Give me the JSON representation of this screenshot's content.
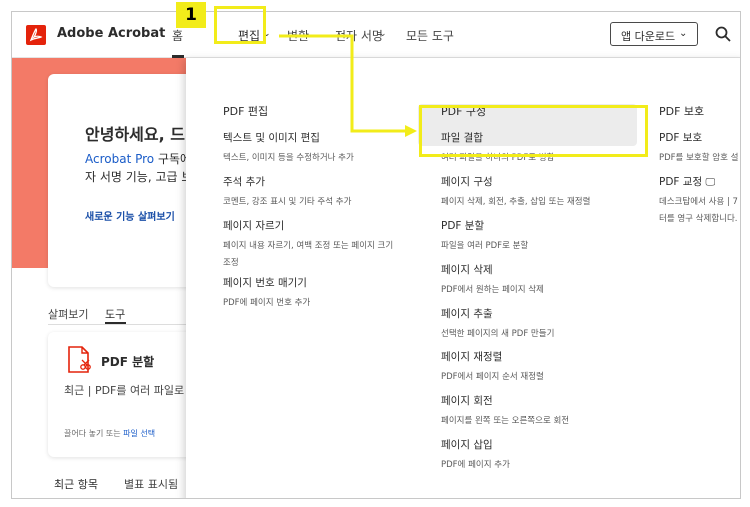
{
  "header": {
    "brand": "Adobe Acrobat",
    "nav": {
      "home": "홈",
      "edit": "편집",
      "convert": "변환",
      "sign": "전자 서명",
      "all_tools": "모든 도구"
    },
    "download_button": "앱 다운로드",
    "step_badge": "1"
  },
  "background": {
    "greeting": "안녕하세요, 드",
    "promo_link": "Acrobat Pro",
    "promo_rest": " 구독에",
    "promo_line2": "자 서명 기능, 고급 보",
    "new_features": "새로운 기능 살펴보기",
    "tabs": {
      "browse": "살펴보기",
      "tools": "도구"
    },
    "tool_card": {
      "title": "PDF 분할",
      "desc": "최근 | PDF를 여러 파일로 분",
      "drop_text": "끌어다 놓기 또는 ",
      "drop_link": "파일 선택"
    },
    "recent": "최근 항목",
    "starred": "별표 표시됨"
  },
  "dropdown": {
    "col1": {
      "heading": "PDF 편집",
      "items": [
        {
          "title": "텍스트 및 이미지 편집",
          "desc": "텍스트, 이미지 등을 수정하거나 추가"
        },
        {
          "title": "주석 추가",
          "desc": "코멘트, 강조 표시 및 기타 주석 추가"
        },
        {
          "title": "페이지 자르기",
          "desc": "페이지 내용 자르기, 여백 조정 또는 페이지 크기",
          "desc2": "조정"
        },
        {
          "title": "페이지 번호 매기기",
          "desc": "PDF에 페이지 번호 추가"
        }
      ]
    },
    "col2": {
      "heading": "PDF 구성",
      "items": [
        {
          "title": "파일 결합",
          "desc": "여러 파일을 하나의 PDF로 병합"
        },
        {
          "title": "페이지 구성",
          "desc": "페이지 삭제, 회전, 추출, 삽입 또는 재정렬"
        },
        {
          "title": "PDF 분할",
          "desc": "파일을 여러 PDF로 분할"
        },
        {
          "title": "페이지 삭제",
          "desc": "PDF에서 원하는 페이지 삭제"
        },
        {
          "title": "페이지 추출",
          "desc": "선택한 페이지의 새 PDF 만들기"
        },
        {
          "title": "페이지 재정렬",
          "desc": "PDF에서 페이지 순서 재정렬"
        },
        {
          "title": "페이지 회전",
          "desc": "페이지를 왼쪽 또는 오른쪽으로 회전"
        },
        {
          "title": "페이지 삽입",
          "desc": "PDF에 페이지 추가"
        }
      ]
    },
    "col3": {
      "heading": "PDF 보호",
      "items": [
        {
          "title": "PDF 보호",
          "desc": "PDF를 보호할 암호 설"
        },
        {
          "title": "PDF 교정",
          "desc": "데스크탑에서 사용 | 7",
          "desc2": "터를 영구 삭제합니다."
        }
      ]
    }
  },
  "colors": {
    "highlight": "#f2ec1a",
    "brand_red": "#e4230b",
    "banner": "#f37a67",
    "link_blue": "#1a5cc8"
  }
}
